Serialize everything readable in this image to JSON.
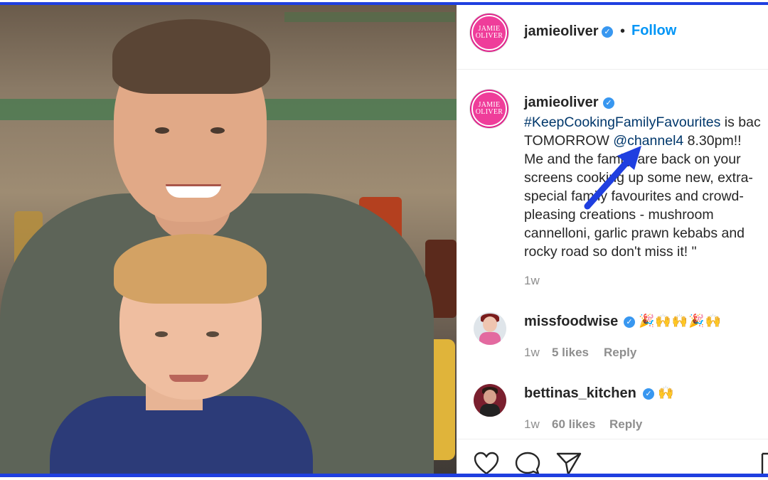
{
  "post": {
    "author": "jamieoliver",
    "avatar_text_line1": "JAMIE",
    "avatar_text_line2": "OLIVER",
    "separator": "•",
    "follow_label": "Follow"
  },
  "caption": {
    "author": "jamieoliver",
    "hashtag": "#KeepCookingFamilyFavourites",
    "line1_rest": " is bac",
    "line2_pre": "TOMORROW ",
    "mention": "@channel4",
    "line2_post": " 8.30pm!!",
    "line3": "Me and the family are back on your",
    "line4": "screens cooking up some new, extra-",
    "line5": "special family favourites and crowd-",
    "line6": "pleasing creations - mushroom",
    "line7": "cannelloni, garlic prawn kebabs and",
    "line8": "rocky road so don't miss it! \"",
    "time": "1w"
  },
  "comments": [
    {
      "username": "missfoodwise",
      "text": "🎉🙌🙌🎉🙌",
      "time": "1w",
      "likes": "5 likes",
      "reply": "Reply"
    },
    {
      "username": "bettinas_kitchen",
      "text": "🙌",
      "time": "1w",
      "likes": "60 likes",
      "reply": "Reply"
    }
  ],
  "icons": [
    "verified-badge-icon",
    "heart-icon",
    "comment-icon",
    "share-icon",
    "bookmark-icon",
    "annotation-arrow"
  ],
  "colors": {
    "frame": "#1f3fe0",
    "link": "#00376b",
    "follow": "#0095f6",
    "verified": "#3897f0",
    "avatar": "#ef3d9a"
  }
}
